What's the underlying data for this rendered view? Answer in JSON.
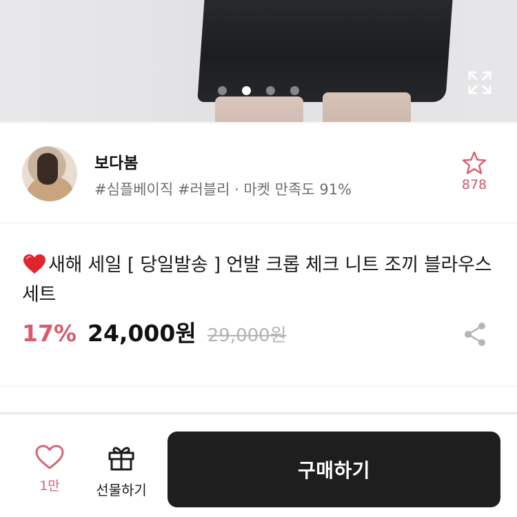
{
  "gallery": {
    "dot_count": 4,
    "active_index": 1
  },
  "shop": {
    "name": "보다봄",
    "tags": "#심플베이직 #러블리 · 마켓 만족도 91%",
    "favorite_count": "878"
  },
  "product": {
    "title": "새해 세일 [ 당일발송 ] 언발 크롭 체크 니트 조끼 블라우스 세트",
    "discount": "17%",
    "price": "24,000원",
    "original_price": "29,000원"
  },
  "bottom_bar": {
    "like_count": "1만",
    "gift_label": "선물하기",
    "buy_label": "구매하기"
  },
  "colors": {
    "accent_pink": "#d95a6d",
    "buy_button": "#1e1e1e"
  },
  "icons": {
    "expand": "expand-icon",
    "star": "star-icon",
    "heart": "heart-icon",
    "gift": "gift-icon",
    "share": "share-icon",
    "title_emoji": "red-heart-emoji"
  }
}
